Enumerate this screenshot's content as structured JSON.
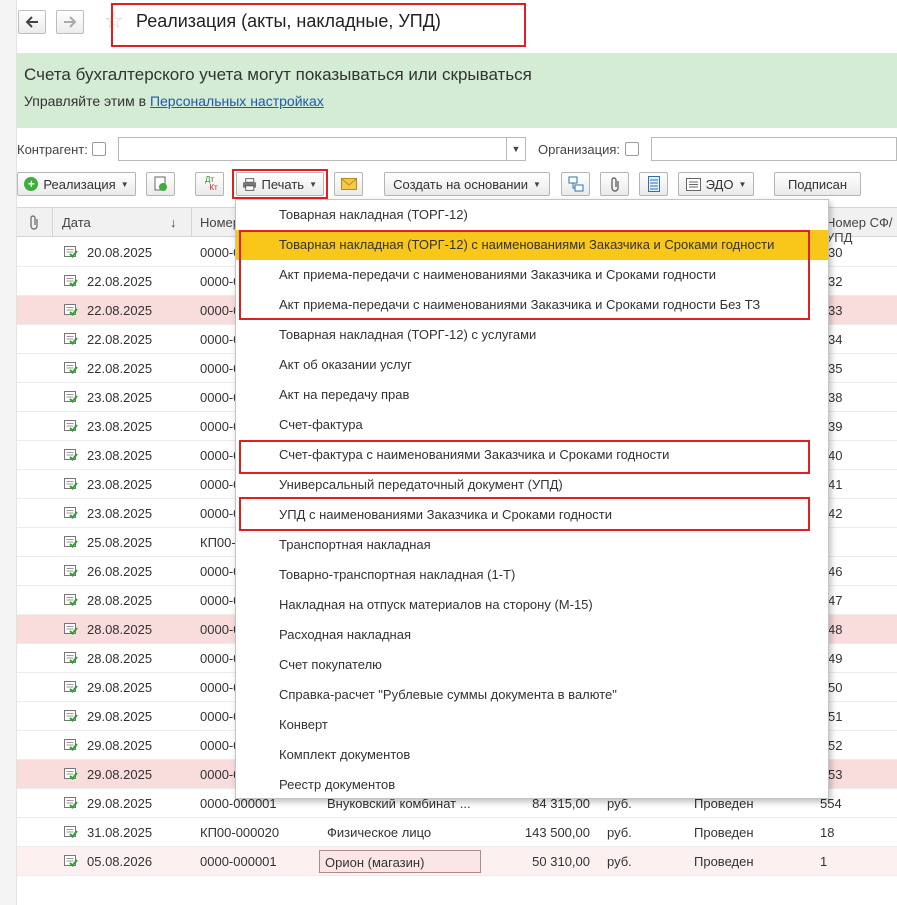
{
  "header": {
    "back_icon": "arrow-left-icon",
    "forward_icon": "arrow-right-icon",
    "favorite_icon": "star-icon",
    "title": "Реализация (акты, накладные, УПД)"
  },
  "banner": {
    "line1": "Счета бухгалтерского учета могут показываться или скрываться",
    "line2_prefix": "Управляйте этим в ",
    "line2_link": "Персональных настройках"
  },
  "filters": {
    "counterparty_label": "Контрагент:",
    "counterparty_value": "",
    "organization_label": "Организация:",
    "organization_value": ""
  },
  "toolbar": {
    "realization_label": "Реализация",
    "print_label": "Печать",
    "create_based_label": "Создать на основании",
    "edo_label": "ЭДО",
    "signed_label": "Подписан",
    "dtkt_label_top": "Дт",
    "dtkt_label_bottom": "Кт"
  },
  "table": {
    "columns": [
      "Дата",
      "Номер",
      "Номер СФ/УПД"
    ],
    "sort_indicator": "↓",
    "rows": [
      {
        "date": "20.08.2025",
        "number": "0000-0",
        "sf": "30",
        "state": "normal"
      },
      {
        "date": "22.08.2025",
        "number": "0000-0",
        "sf": "32",
        "state": "normal"
      },
      {
        "date": "22.08.2025",
        "number": "0000-0",
        "sf": "33",
        "state": "pink"
      },
      {
        "date": "22.08.2025",
        "number": "0000-0",
        "sf": "34",
        "state": "normal"
      },
      {
        "date": "22.08.2025",
        "number": "0000-0",
        "sf": "35",
        "state": "normal"
      },
      {
        "date": "23.08.2025",
        "number": "0000-0",
        "sf": "38",
        "state": "normal"
      },
      {
        "date": "23.08.2025",
        "number": "0000-0",
        "sf": "39",
        "state": "normal"
      },
      {
        "date": "23.08.2025",
        "number": "0000-0",
        "sf": "40",
        "state": "normal"
      },
      {
        "date": "23.08.2025",
        "number": "0000-0",
        "sf": "41",
        "state": "normal"
      },
      {
        "date": "23.08.2025",
        "number": "0000-0",
        "sf": "42",
        "state": "normal"
      },
      {
        "date": "25.08.2025",
        "number": "КП00-",
        "sf": "",
        "state": "normal"
      },
      {
        "date": "26.08.2025",
        "number": "0000-0",
        "sf": "46",
        "state": "normal"
      },
      {
        "date": "28.08.2025",
        "number": "0000-0",
        "sf": "47",
        "state": "normal"
      },
      {
        "date": "28.08.2025",
        "number": "0000-0",
        "sf": "48",
        "state": "pink"
      },
      {
        "date": "28.08.2025",
        "number": "0000-0",
        "sf": "49",
        "state": "normal"
      },
      {
        "date": "29.08.2025",
        "number": "0000-0",
        "sf": "50",
        "state": "normal"
      },
      {
        "date": "29.08.2025",
        "number": "0000-0",
        "sf": "51",
        "state": "normal"
      },
      {
        "date": "29.08.2025",
        "number": "0000-0",
        "sf": "52",
        "state": "normal"
      },
      {
        "date": "29.08.2025",
        "number": "0000-0",
        "sf": "53",
        "state": "pink"
      }
    ],
    "full_rows": [
      {
        "date": "29.08.2025",
        "number": "0000-000001",
        "counterparty": "Внуковский комбинат ...",
        "sum": "84 315,00",
        "currency": "руб.",
        "status": "Проведен",
        "sf": "554",
        "state": "normal"
      },
      {
        "date": "31.08.2025",
        "number": "КП00-000020",
        "counterparty": "Физическое лицо",
        "sum": "143 500,00",
        "currency": "руб.",
        "status": "Проведен",
        "sf": "18",
        "state": "normal"
      },
      {
        "date": "05.08.2026",
        "number": "0000-000001",
        "counterparty": "Орион (магазин)",
        "sum": "50 310,00",
        "currency": "руб.",
        "status": "Проведен",
        "sf": "1",
        "state": "sel"
      }
    ]
  },
  "print_menu": {
    "items": [
      "Товарная накладная (ТОРГ-12)",
      "Товарная накладная (ТОРГ-12) с наименованиями Заказчика и Сроками годности",
      "Акт приема-передачи с наименованиями Заказчика и Сроками годности",
      "Акт приема-передачи с наименованиями Заказчика и Сроками годности Без ТЗ",
      "Товарная накладная (ТОРГ-12) с услугами",
      "Акт об оказании услуг",
      "Акт на передачу прав",
      "Счет-фактура",
      "Счет-фактура с наименованиями Заказчика и Сроками годности",
      "Универсальный передаточный документ (УПД)",
      "УПД с наименованиями Заказчика и Сроками годности",
      "Транспортная накладная",
      "Товарно-транспортная накладная (1-Т)",
      "Накладная на отпуск материалов на сторону (М-15)",
      "Расходная накладная",
      "Счет покупателю",
      "Справка-расчет \"Рублевые суммы документа в валюте\"",
      "Конверт",
      "Комплект документов",
      "Реестр документов"
    ],
    "highlighted_index": 1
  },
  "colors": {
    "banner_bg": "#d4ebd4",
    "highlight": "#f9c61a",
    "annotation_red": "#e02020",
    "row_pink": "#f9dcdc",
    "link": "#1c59b3"
  }
}
